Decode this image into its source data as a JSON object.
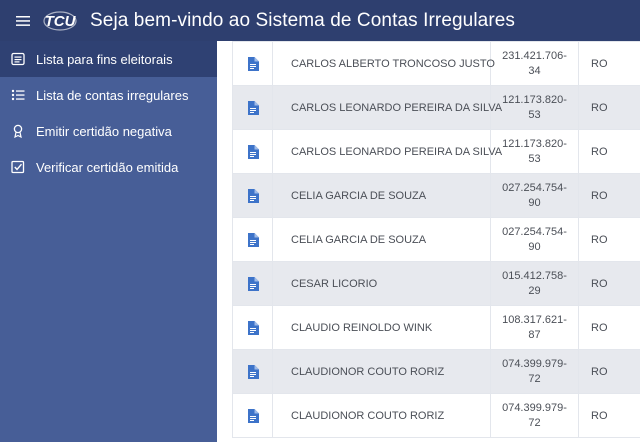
{
  "header": {
    "title": "Seja bem-vindo ao Sistema de Contas Irregulares",
    "logo_text": "TCU",
    "menu_icon": "hamburger-icon"
  },
  "sidebar": {
    "items": [
      {
        "label": "Lista para fins eleitorais",
        "icon": "list-box-icon",
        "active": true
      },
      {
        "label": "Lista de contas irregulares",
        "icon": "bullet-list-icon",
        "active": false
      },
      {
        "label": "Emitir certidão negativa",
        "icon": "award-icon",
        "active": false
      },
      {
        "label": "Verificar certidão emitida",
        "icon": "checkbox-icon",
        "active": false
      }
    ]
  },
  "table": {
    "rows": [
      {
        "name": "CARLOS ALBERTO TRONCOSO JUSTO",
        "cpf_a": "231.421.706-",
        "cpf_b": "34",
        "uf": "RO"
      },
      {
        "name": "CARLOS LEONARDO PEREIRA DA SILVA",
        "cpf_a": "121.173.820-",
        "cpf_b": "53",
        "uf": "RO"
      },
      {
        "name": "CARLOS LEONARDO PEREIRA DA SILVA",
        "cpf_a": "121.173.820-",
        "cpf_b": "53",
        "uf": "RO"
      },
      {
        "name": "CELIA GARCIA DE SOUZA",
        "cpf_a": "027.254.754-",
        "cpf_b": "90",
        "uf": "RO"
      },
      {
        "name": "CELIA GARCIA DE SOUZA",
        "cpf_a": "027.254.754-",
        "cpf_b": "90",
        "uf": "RO"
      },
      {
        "name": "CESAR LICORIO",
        "cpf_a": "015.412.758-",
        "cpf_b": "29",
        "uf": "RO"
      },
      {
        "name": "CLAUDIO REINOLDO WINK",
        "cpf_a": "108.317.621-",
        "cpf_b": "87",
        "uf": "RO"
      },
      {
        "name": "CLAUDIONOR COUTO RORIZ",
        "cpf_a": "074.399.979-",
        "cpf_b": "72",
        "uf": "RO"
      },
      {
        "name": "CLAUDIONOR COUTO RORIZ",
        "cpf_a": "074.399.979-",
        "cpf_b": "72",
        "uf": "RO"
      }
    ]
  },
  "colors": {
    "topbar": "#2e3f6f",
    "sidebar": "#475e97",
    "sidebar_active": "#2f4173",
    "doc_icon": "#3d73c9",
    "row_alt": "#e7e9ee"
  }
}
